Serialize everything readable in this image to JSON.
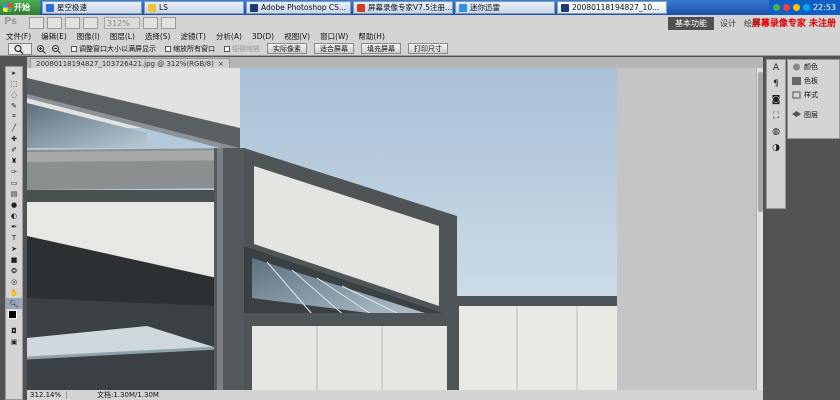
{
  "taskbar": {
    "start": "开始",
    "items": [
      {
        "label": "星空极速",
        "color": "#2a6fd6"
      },
      {
        "label": "LS",
        "color": "#f0c040"
      },
      {
        "label": "Adobe Photoshop CS...",
        "color": "#1c3c70"
      },
      {
        "label": "屏幕录像专家V7.5注册...",
        "color": "#d04020"
      },
      {
        "label": "迷你迅雷",
        "color": "#3a90e0"
      },
      {
        "label": "20080118194827_10...",
        "color": "#1c3c70"
      }
    ],
    "clock": "22:53"
  },
  "appbar": {
    "logo": "Ps",
    "zoom": "312%",
    "essentials": "基本功能",
    "design": "设计",
    "painting": "绘画",
    "watermark": "屏幕录像专家 未注册"
  },
  "menu": [
    "文件(F)",
    "编辑(E)",
    "图像(I)",
    "图层(L)",
    "选择(S)",
    "滤镜(T)",
    "分析(A)",
    "3D(D)",
    "视图(V)",
    "窗口(W)",
    "帮助(H)"
  ],
  "options": {
    "resize_windows": "调整窗口大小以满屏显示",
    "zoom_all": "缩放所有窗口",
    "scrubby": "细微缩放",
    "actual_pixels": "实际像素",
    "fit_screen": "适合屏幕",
    "fill_screen": "填充屏幕",
    "print_size": "打印尺寸"
  },
  "document": {
    "tab_title": "20080118194827_103726421.jpg @ 312%(RGB/8)",
    "status_zoom": "312.14%",
    "status_doc": "文档:1.30M/1.30M"
  },
  "panels": {
    "color": "颜色",
    "swatches": "色板",
    "styles": "样式",
    "layers": "图层"
  }
}
